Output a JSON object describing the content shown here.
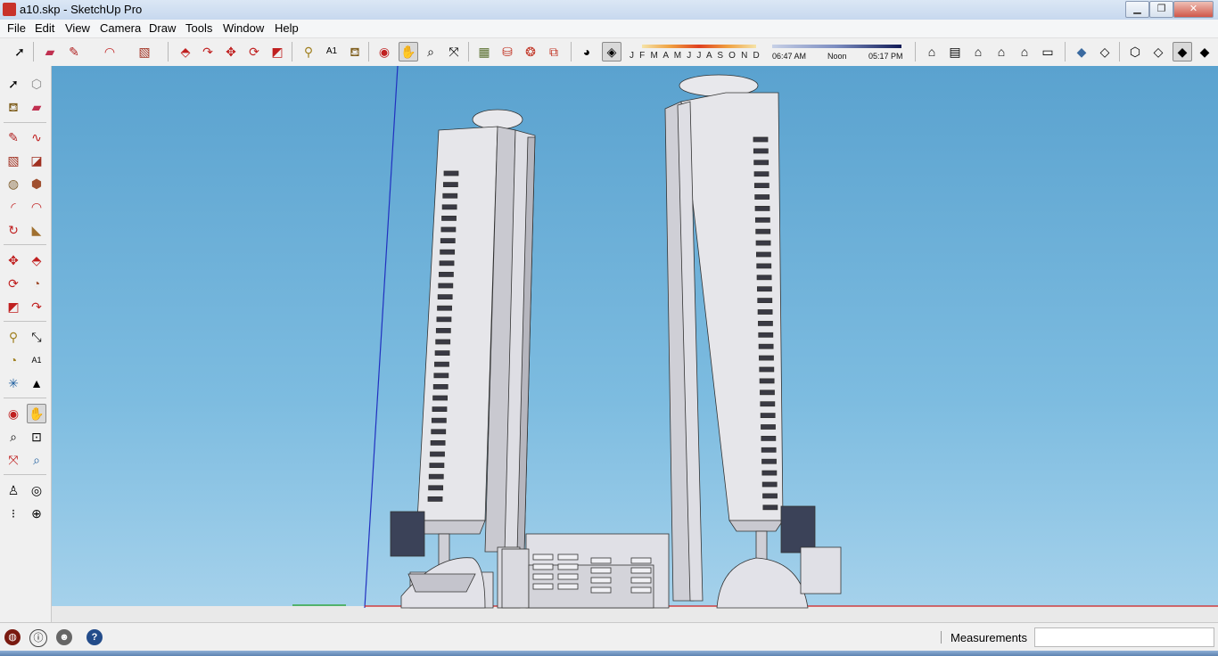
{
  "window": {
    "title": "a10.skp - SketchUp Pro"
  },
  "menu": [
    "File",
    "Edit",
    "View",
    "Camera",
    "Draw",
    "Tools",
    "Window",
    "Help"
  ],
  "shadow_settings": {
    "months_label": "J F M A M J J A S O N D",
    "time_start": "06:47 AM",
    "time_mid": "Noon",
    "time_end": "05:17 PM"
  },
  "status": {
    "measurements_label": "Measurements",
    "measurements_value": ""
  },
  "colors": {
    "sky_top": "#5aa2cf",
    "sky_bottom": "#a8d3ec",
    "building": "#e6e6ea",
    "red_axis": "#d02020",
    "blue_axis": "#2030c0",
    "green_axis": "#20a020"
  },
  "icons": {
    "top_toolbar": [
      "select-icon",
      "eraser-icon",
      "pencil-icon",
      "arc-icon",
      "rectangle-icon",
      "push-pull-icon",
      "follow-me-icon",
      "move-icon",
      "rotate-icon",
      "scale-icon",
      "tape-measure-icon",
      "text-icon",
      "paint-bucket-icon",
      "orbit-icon",
      "pan-icon",
      "zoom-icon",
      "zoom-extents-icon",
      "components-icon",
      "warehouse-icon",
      "extension-icon",
      "shadow-icon",
      "fog-icon",
      "iso-view-icon",
      "top-view-icon",
      "front-view-icon",
      "right-view-icon",
      "back-view-icon",
      "left-view-icon",
      "xray-icon",
      "wireframe-icon",
      "hidden-line-icon",
      "shaded-icon",
      "shaded-texture-icon",
      "monochrome-icon"
    ],
    "left_toolbar": [
      "select-icon",
      "component-icon",
      "paint-bucket-icon",
      "eraser-icon",
      "line-icon",
      "freehand-icon",
      "rectangle-icon",
      "rotated-rectangle-icon",
      "circle-icon",
      "polygon-icon",
      "arc-icon",
      "pie-icon",
      "two-point-arc-icon",
      "three-point-arc-icon",
      "move-icon",
      "push-pull-icon",
      "rotate-icon",
      "follow-me-icon",
      "scale-icon",
      "offset-icon",
      "tape-measure-icon",
      "dimension-icon",
      "protractor-icon",
      "text-icon",
      "axes-icon",
      "3d-text-icon",
      "orbit-icon",
      "pan-icon",
      "zoom-icon",
      "zoom-window-icon",
      "zoom-extents-icon",
      "previous-view-icon",
      "walk-icon",
      "look-around-icon",
      "position-camera-icon",
      "section-plane-icon"
    ],
    "status": [
      "geo-location-icon",
      "credits-icon",
      "user-icon",
      "help-icon"
    ]
  }
}
